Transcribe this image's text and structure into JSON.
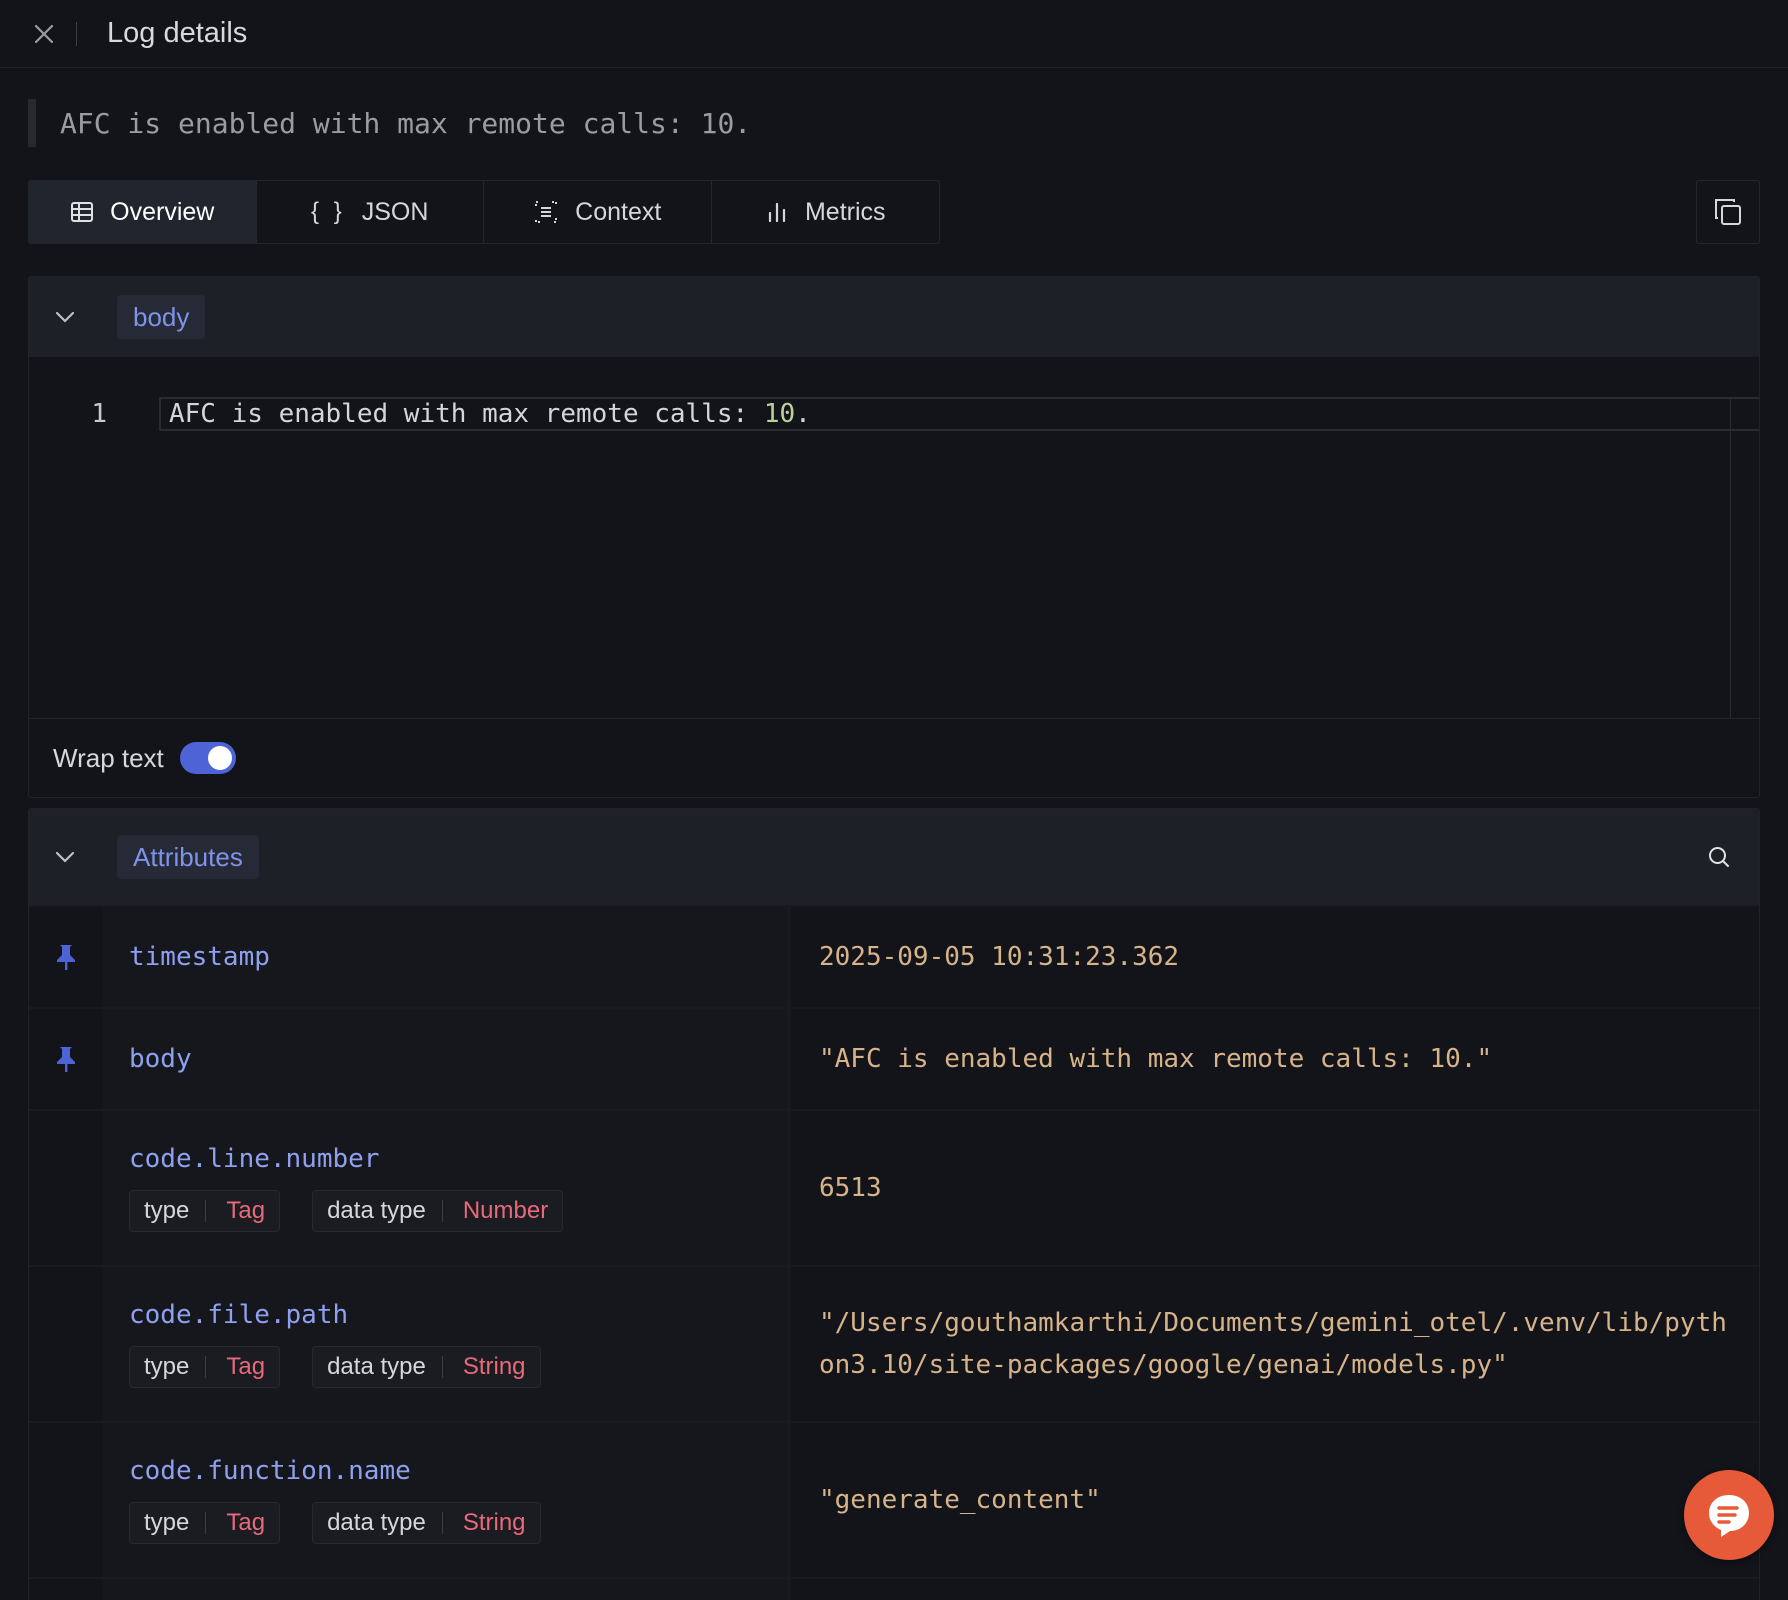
{
  "header": {
    "title": "Log details"
  },
  "message": "AFC is enabled with max remote calls: 10.",
  "tabs": [
    {
      "label": "Overview",
      "icon": "table-icon",
      "active": true
    },
    {
      "label": "JSON",
      "icon": "braces-icon",
      "active": false
    },
    {
      "label": "Context",
      "icon": "context-icon",
      "active": false
    },
    {
      "label": "Metrics",
      "icon": "bar-chart-icon",
      "active": false
    }
  ],
  "body_section": {
    "title": "body",
    "line_number": "1",
    "code_prefix": "AFC is enabled with max remote calls: ",
    "code_number": "10",
    "code_suffix": ".",
    "wrap_label": "Wrap text",
    "wrap_enabled": true
  },
  "attributes_section": {
    "title": "Attributes",
    "rows": [
      {
        "key": "timestamp",
        "value": "2025-09-05 10:31:23.362",
        "pinned": true
      },
      {
        "key": "body",
        "value": "\"AFC is enabled with max remote calls: 10.\"",
        "pinned": true
      },
      {
        "key": "code.line.number",
        "value": "6513",
        "pinned": false,
        "type_label": "type",
        "type_value": "Tag",
        "dtype_label": "data type",
        "dtype_value": "Number"
      },
      {
        "key": "code.file.path",
        "value": "\"/Users/gouthamkarthi/Documents/gemini_otel/.venv/lib/python3.10/site-packages/google/genai/models.py\"",
        "pinned": false,
        "type_label": "type",
        "type_value": "Tag",
        "dtype_label": "data type",
        "dtype_value": "String"
      },
      {
        "key": "code.function.name",
        "value": "\"generate_content\"",
        "pinned": false,
        "type_label": "type",
        "type_value": "Tag",
        "dtype_label": "data type",
        "dtype_value": "String"
      }
    ]
  },
  "colors": {
    "accent": "#4e63d6",
    "key": "#8ea0ee",
    "value": "#d7b38a",
    "tag_value": "#e8697a",
    "chat": "#e65a3a"
  }
}
